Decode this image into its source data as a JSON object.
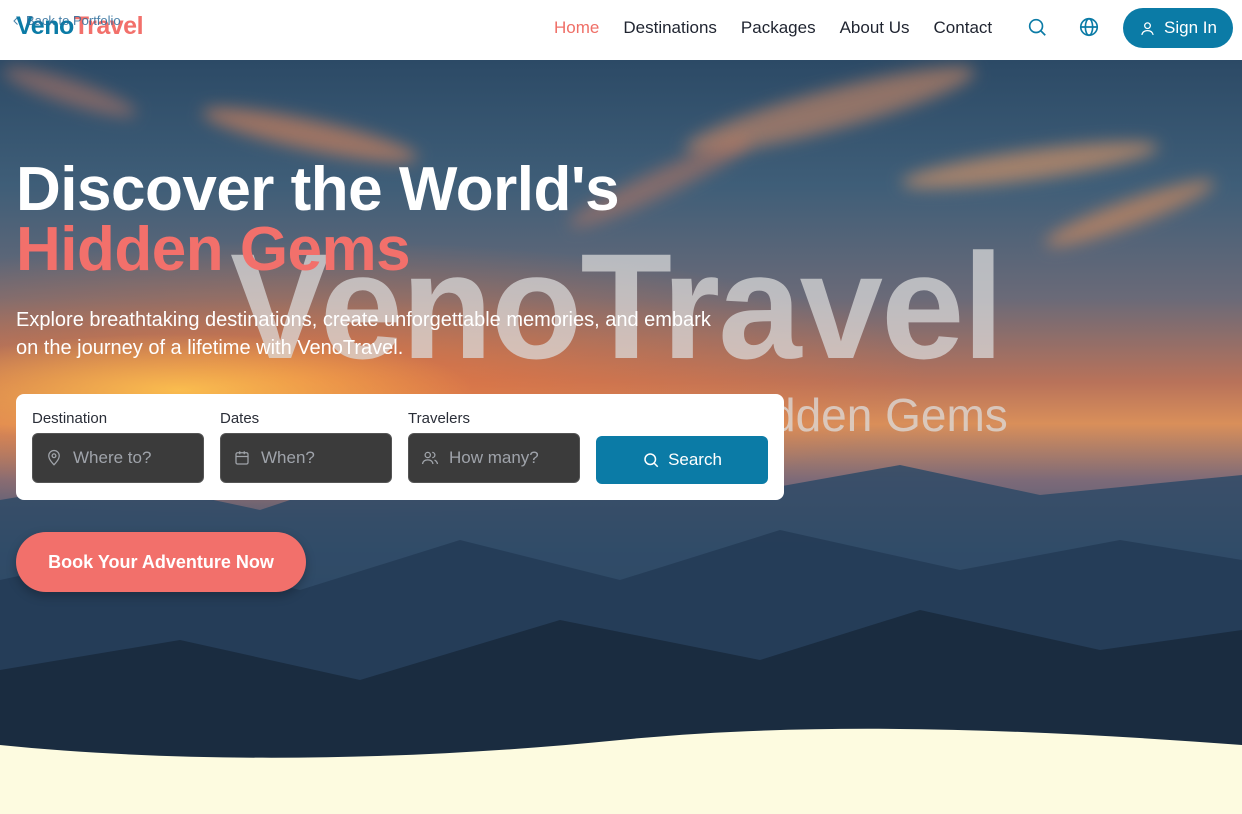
{
  "header": {
    "back_link": "Back to Portfolio",
    "logo_part1": "Veno",
    "logo_part2": "Travel",
    "nav": [
      {
        "label": "Home",
        "active": true
      },
      {
        "label": "Destinations",
        "active": false
      },
      {
        "label": "Packages",
        "active": false
      },
      {
        "label": "About Us",
        "active": false
      },
      {
        "label": "Contact",
        "active": false
      }
    ],
    "search_icon": "search-icon",
    "language_icon": "globe-icon",
    "signin_label": "Sign In"
  },
  "hero": {
    "title_line1": "Discover the World's",
    "title_line2": "Hidden Gems",
    "subtitle": "Explore breathtaking destinations, create unforgettable memories, and embark on the journey of a lifetime with VenoTravel.",
    "watermark": "VenoTravel",
    "watermark_sub": "dden Gems"
  },
  "search": {
    "destination_label": "Destination",
    "destination_placeholder": "Where to?",
    "dates_label": "Dates",
    "dates_placeholder": "When?",
    "travelers_label": "Travelers",
    "travelers_placeholder": "How many?",
    "button_label": "Search"
  },
  "cta_label": "Book Your Adventure Now",
  "colors": {
    "primary": "#0b7ba6",
    "accent": "#f2706b",
    "footer_bg": "#fdfbe0"
  }
}
